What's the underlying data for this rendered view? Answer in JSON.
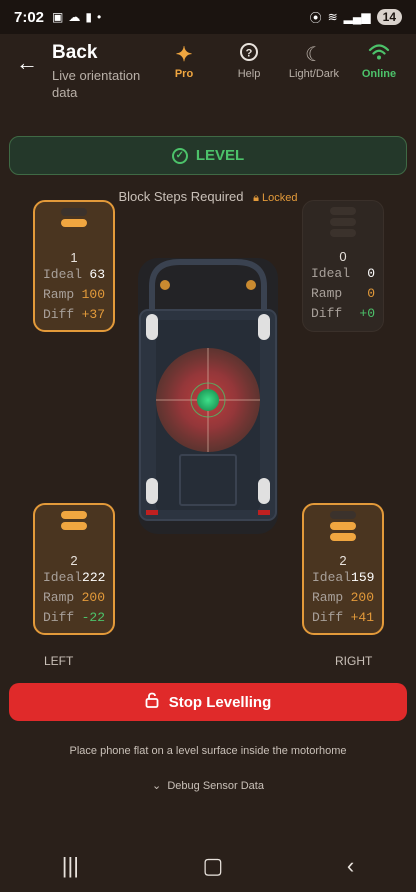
{
  "status": {
    "time": "7:02",
    "battery": "14"
  },
  "header": {
    "title": "Back",
    "subtitle": "Live orientation data",
    "pro_label": "Pro",
    "help_label": "Help",
    "theme_label": "Light/Dark",
    "online_label": "Online"
  },
  "level_banner": {
    "label": "LEVEL",
    "color": "#4cc26a"
  },
  "blocks": {
    "title": "Block Steps Required",
    "locked_label": "Locked"
  },
  "wheels": {
    "front_left": {
      "steps": "1",
      "ideal": "63",
      "ramp": "100",
      "diff": "+37",
      "ideal_label": "Ideal",
      "ramp_label": "Ramp",
      "diff_label": "Diff"
    },
    "front_right": {
      "steps": "0",
      "ideal": "0",
      "ramp": "0",
      "diff": "+0",
      "ideal_label": "Ideal",
      "ramp_label": "Ramp",
      "diff_label": "Diff"
    },
    "rear_left": {
      "steps": "2",
      "ideal": "222",
      "ramp": "200",
      "diff": "-22",
      "ideal_label": "Ideal",
      "ramp_label": "Ramp",
      "diff_label": "Diff"
    },
    "rear_right": {
      "steps": "2",
      "ideal": "159",
      "ramp": "200",
      "diff": "+41",
      "ideal_label": "Ideal",
      "ramp_label": "Ramp",
      "diff_label": "Diff"
    }
  },
  "labels": {
    "left": "LEFT",
    "right": "RIGHT"
  },
  "actions": {
    "stop_label": "Stop Levelling",
    "hint": "Place phone flat on a level surface inside the motorhome",
    "debug_label": "Debug Sensor Data"
  },
  "colors": {
    "accent": "#e39a3a",
    "ok": "#4cc26a",
    "danger": "#e02a2a"
  }
}
